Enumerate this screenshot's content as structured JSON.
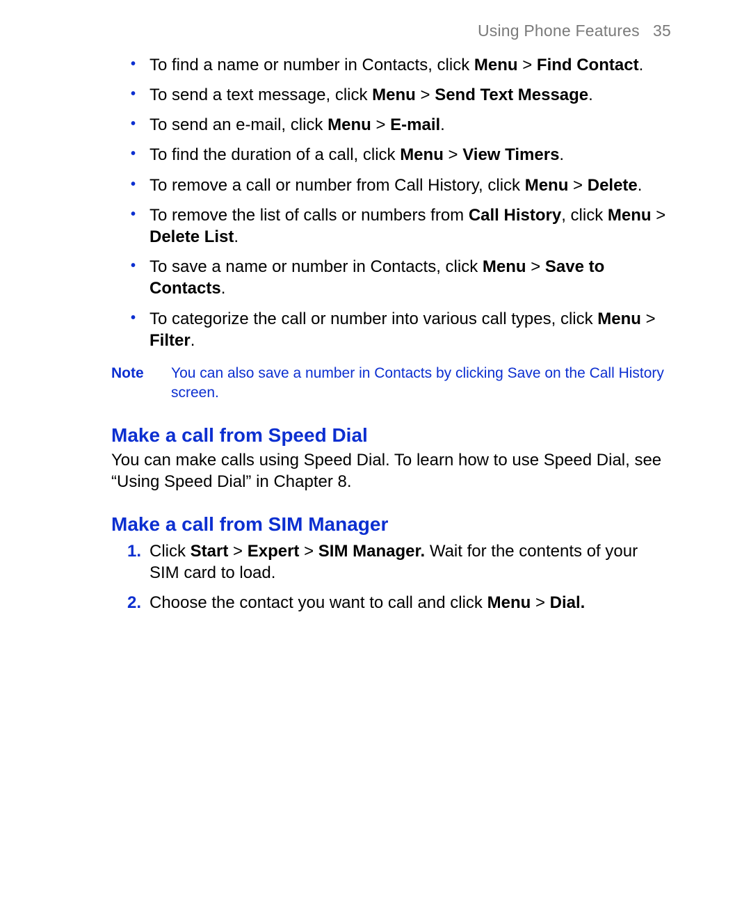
{
  "header": {
    "title": "Using Phone Features",
    "page_number": "35"
  },
  "bullets": [
    {
      "pre": "To find a name or number in Contacts, click ",
      "b1": "Menu",
      "mid1": " > ",
      "b2": "Find Contact",
      "post": "."
    },
    {
      "pre": "To send a text message, click ",
      "b1": "Menu",
      "mid1": " > ",
      "b2": "Send Text Message",
      "post": "."
    },
    {
      "pre": "To send an e-mail, click ",
      "b1": "Menu",
      "mid1": " > ",
      "b2": "E-mail",
      "post": "."
    },
    {
      "pre": "To find the duration of a call, click ",
      "b1": "Menu",
      "mid1": " > ",
      "b2": "View Timers",
      "post": "."
    },
    {
      "pre": "To remove a call or number from Call History, click ",
      "b1": "Menu",
      "mid1": " > ",
      "b2": "Delete",
      "post": "."
    },
    {
      "pre": "To remove the list of calls or numbers from ",
      "pb1": "Call History",
      "pmid": ", click ",
      "b1": "Menu",
      "mid1": " > ",
      "b2": "Delete List",
      "post": "."
    },
    {
      "pre": "To save a name or number in Contacts, click ",
      "b1": "Menu",
      "mid1": " > ",
      "b2": "Save to Contacts",
      "post": "."
    },
    {
      "pre": "To categorize the call or number into various call types, click ",
      "b1": "Menu",
      "mid1": " > ",
      "b2": "Filter",
      "post": "."
    }
  ],
  "note": {
    "label": "Note",
    "text": "You can also save a number in Contacts by clicking Save on the Call History screen."
  },
  "section1": {
    "title": "Make a call from Speed Dial",
    "para": "You can make calls using Speed Dial. To learn how to use Speed Dial, see “Using Speed Dial” in Chapter 8."
  },
  "section2": {
    "title": "Make a call from SIM Manager",
    "steps": [
      {
        "num": "1.",
        "pre": "Click ",
        "b1": "Start",
        "mid1": " > ",
        "b2": "Expert",
        "mid2": " > ",
        "b3": "SIM Manager.",
        "post": " Wait for the contents of your SIM card to load."
      },
      {
        "num": "2.",
        "pre": "Choose the contact you want to call and click ",
        "b1": "Menu",
        "mid1": " > ",
        "b2": "Dial.",
        "post": ""
      }
    ]
  }
}
